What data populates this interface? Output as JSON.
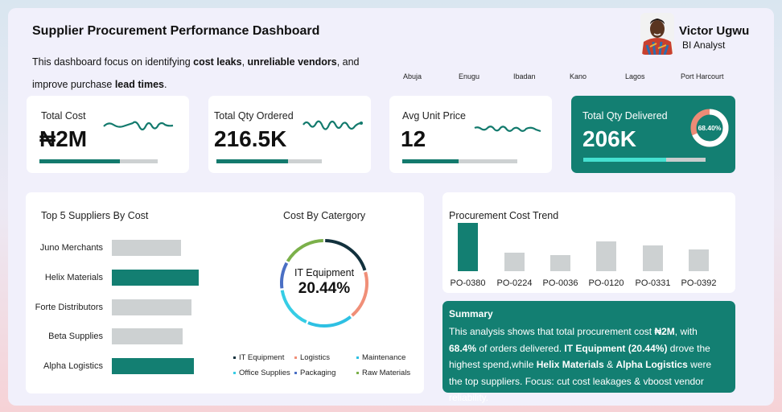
{
  "header": {
    "title": "Supplier Procurement Performance Dashboard",
    "desc_parts": [
      "This dashboard focus on identifying ",
      "cost leaks",
      ", ",
      "unreliable vendors",
      ", and improve purchase ",
      "lead times",
      "."
    ]
  },
  "profile": {
    "name": "Victor Ugwu",
    "role": "BI Analyst"
  },
  "cities": [
    "Abuja",
    "Enugu",
    "Ibadan",
    "Kano",
    "Lagos",
    "Port Harcourt"
  ],
  "kpis": [
    {
      "label": "Total Cost",
      "value": "₦2M",
      "progress": 0.68
    },
    {
      "label": "Total Qty Ordered",
      "value": "216.5K",
      "progress": 0.68
    },
    {
      "label": "Avg Unit Price",
      "value": "12",
      "progress": 0.49
    },
    {
      "label": "Total Qty Delivered",
      "value": "206K",
      "progress": 0.68,
      "donut_label": "68.40%",
      "donut_value": 0.684
    }
  ],
  "colors": {
    "teal": "#137f72",
    "grey": "#cdd1d2",
    "cyan": "#45e0d0",
    "donut_bg": "#ec8b76"
  },
  "chart_data": [
    {
      "type": "bar",
      "orientation": "horizontal",
      "title": "Top 5 Suppliers By Cost",
      "categories": [
        "Juno Merchants",
        "Helix Materials",
        "Forte Distributors",
        "Beta Supplies",
        "Alpha Logistics"
      ],
      "values": [
        86,
        108,
        99,
        88,
        102
      ],
      "highlight": [
        "Helix Materials",
        "Alpha Logistics"
      ]
    },
    {
      "type": "pie",
      "style": "donut",
      "title": "Cost By Catergory",
      "center_label": "IT Equipment",
      "center_value": "20.44%",
      "slices": [
        {
          "name": "IT Equipment",
          "value": 20.44,
          "color": "#12313d"
        },
        {
          "name": "Logistics",
          "value": 18.6,
          "color": "#f08f78"
        },
        {
          "name": "Maintenance",
          "value": 17.5,
          "color": "#2ec0e3"
        },
        {
          "name": "Office Supplies",
          "value": 16.2,
          "color": "#36cde5"
        },
        {
          "name": "Packaging",
          "value": 10.5,
          "color": "#4a6fc4"
        },
        {
          "name": "Raw Materials",
          "value": 16.76,
          "color": "#7bb04a"
        }
      ],
      "legend_position": "bottom"
    },
    {
      "type": "bar",
      "title": "Procurement Cost Trend",
      "categories": [
        "PO-0380",
        "PO-0224",
        "PO-0036",
        "PO-0120",
        "PO-0331",
        "PO-0392"
      ],
      "values": [
        100,
        38,
        33,
        62,
        54,
        45
      ],
      "highlight": [
        "PO-0380"
      ]
    }
  ],
  "summary": {
    "title": "Summary",
    "parts": [
      [
        "This analysis shows that total procurement cost ",
        false
      ],
      [
        "₦2M",
        true
      ],
      [
        ", with ",
        false
      ],
      [
        "68.4%",
        true
      ],
      [
        " of orders delivered. ",
        false
      ],
      [
        "IT Equipment (20.44%)",
        true
      ],
      [
        " drove the highest spend,while ",
        false
      ],
      [
        "Helix Materials",
        true
      ],
      [
        " & ",
        false
      ],
      [
        "Alpha Logistics",
        true
      ],
      [
        " were the top suppliers.  Focus: cut cost leakages & vboost vendor reliability.",
        false
      ]
    ]
  }
}
